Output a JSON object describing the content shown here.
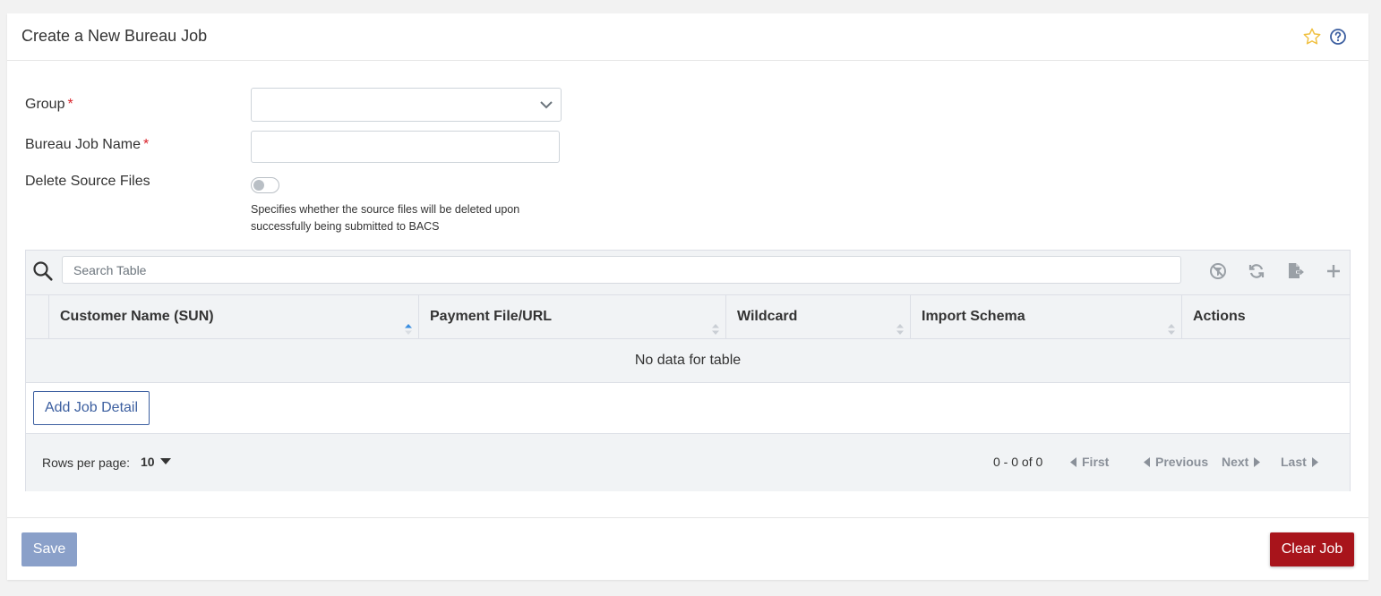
{
  "header": {
    "title": "Create a New Bureau Job",
    "icons": [
      "star-icon",
      "help-icon"
    ]
  },
  "form": {
    "group": {
      "label": "Group",
      "required_mark": "*",
      "value": ""
    },
    "job_name": {
      "label": "Bureau Job Name",
      "required_mark": "*",
      "value": "",
      "placeholder": ""
    },
    "delete_source": {
      "label": "Delete Source Files",
      "checked": false,
      "help": "Specifies whether the source files will be deleted upon successfully being submitted to BACS"
    }
  },
  "table": {
    "search_placeholder": "Search Table",
    "toolbar_icons": [
      "clear-filter-icon",
      "refresh-icon",
      "export-icon",
      "add-icon"
    ],
    "columns": [
      {
        "label": "Customer Name (SUN)",
        "sort": "asc"
      },
      {
        "label": "Payment File/URL",
        "sort": "none"
      },
      {
        "label": "Wildcard",
        "sort": "none"
      },
      {
        "label": "Import Schema",
        "sort": "none"
      },
      {
        "label": "Actions",
        "sort": "none"
      }
    ],
    "empty_text": "No data for table",
    "add_button": "Add Job Detail",
    "pagination": {
      "rows_per_page_label": "Rows per page:",
      "rows_per_page": "10",
      "info": "0 - 0 of 0",
      "first": "First",
      "previous": "Previous",
      "next": "Next",
      "last": "Last"
    }
  },
  "actions": {
    "save": "Save",
    "clear": "Clear Job"
  },
  "colors": {
    "accent": "#3c5fa0",
    "save_disabled": "#8aa0c9",
    "danger": "#a8141b",
    "required": "#d9222a",
    "star": "#f0c040"
  }
}
